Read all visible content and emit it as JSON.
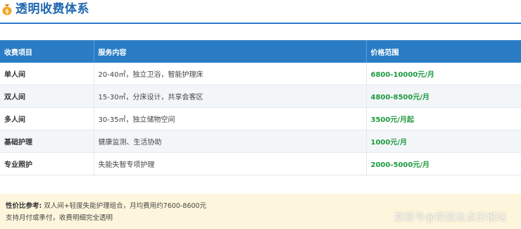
{
  "header": {
    "title": "透明收费体系",
    "icon": "money-bag-icon",
    "accent": "#1f67b0"
  },
  "table": {
    "columns": [
      "收费项目",
      "服务内容",
      "价格范围"
    ],
    "rows": [
      {
        "item": "单人间",
        "service": "20-40㎡，独立卫浴，智能护理床",
        "price": "6800-10000元/月"
      },
      {
        "item": "双人间",
        "service": "15-30㎡，分床设计，共享会客区",
        "price": "4800-8500元/月"
      },
      {
        "item": "多人间",
        "service": "30-35㎡，独立储物空间",
        "price": "3500元/月起"
      },
      {
        "item": "基础护理",
        "service": "健康监测、生活协助",
        "price": "1000元/月"
      },
      {
        "item": "专业照护",
        "service": "失能失智专项护理",
        "price": "2000-5000元/月"
      }
    ],
    "header_color": "#2a7dc5",
    "price_color": "#1e9a3f"
  },
  "note": {
    "label": "性价比参考:",
    "text": "双人间+轻度失能护理组合，月均费用约7600-8600元",
    "line2": "支持月付或季付，收费明细完全透明",
    "background": "#fdf6dc"
  },
  "watermark": "搜狐号@搜狐焦点白银站"
}
